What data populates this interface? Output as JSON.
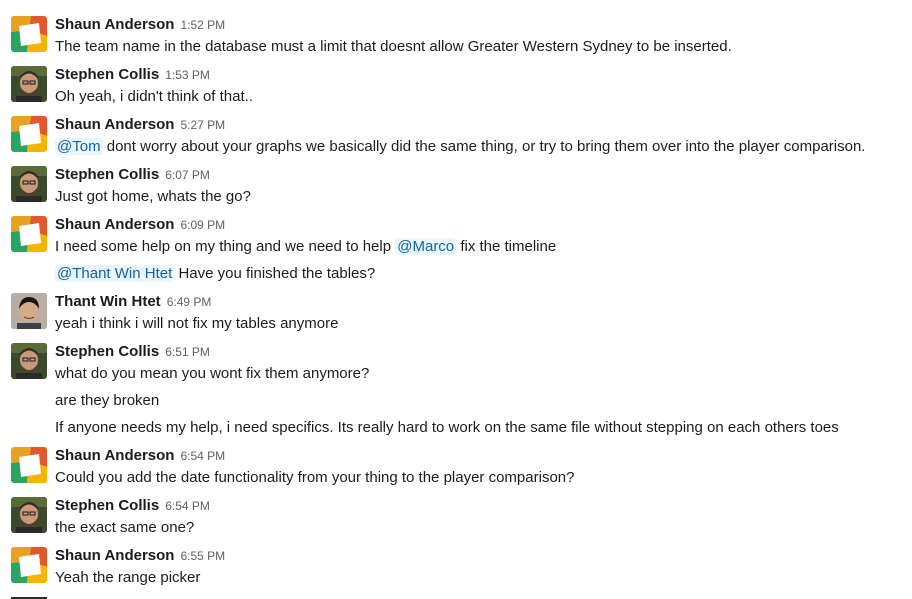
{
  "colors": {
    "mention_text": "#1264a3",
    "mention_bg": "#e8f5fa",
    "timestamp": "#616061"
  },
  "messages": [
    {
      "author": "Shaun Anderson",
      "time": "1:52 PM",
      "avatar": "shaun-avatar",
      "lines": [
        {
          "text": "The team name in the database must a limit that doesnt allow Greater Western Sydney to be inserted."
        }
      ]
    },
    {
      "author": "Stephen Collis",
      "time": "1:53 PM",
      "avatar": "stephen-avatar",
      "lines": [
        {
          "text": "Oh yeah, i didn't think of that.."
        }
      ]
    },
    {
      "author": "Shaun Anderson",
      "time": "5:27 PM",
      "avatar": "shaun-avatar",
      "lines": [
        {
          "mention": "@Tom",
          "text": "dont worry about your graphs we basically did the same thing, or try to bring them over into the player comparison."
        }
      ]
    },
    {
      "author": "Stephen Collis",
      "time": "6:07 PM",
      "avatar": "stephen-avatar",
      "lines": [
        {
          "text": "Just got home, whats the go?"
        }
      ]
    },
    {
      "author": "Shaun Anderson",
      "time": "6:09 PM",
      "avatar": "shaun-avatar",
      "lines": [
        {
          "text_before": "I need some help on my thing and we need to help",
          "mention": "@Marco",
          "text": "fix the timeline"
        },
        {
          "mention": "@Thant Win Htet",
          "text": "Have you finished the tables?"
        }
      ]
    },
    {
      "author": "Thant Win Htet",
      "time": "6:49 PM",
      "avatar": "thant-avatar",
      "lines": [
        {
          "text": "yeah i think i will not fix my tables anymore"
        }
      ]
    },
    {
      "author": "Stephen Collis",
      "time": "6:51 PM",
      "avatar": "stephen-avatar",
      "lines": [
        {
          "text": "what do you mean you wont fix them anymore?"
        },
        {
          "text": "are they broken"
        },
        {
          "text": "If anyone needs my help, i need specifics. Its really hard to work on the same file without stepping on each others toes"
        }
      ]
    },
    {
      "author": "Shaun Anderson",
      "time": "6:54 PM",
      "avatar": "shaun-avatar",
      "lines": [
        {
          "text": "Could you add the date functionality from your thing to the player comparison?"
        }
      ]
    },
    {
      "author": "Stephen Collis",
      "time": "6:54 PM",
      "avatar": "stephen-avatar",
      "lines": [
        {
          "text": "the exact same one?"
        }
      ]
    },
    {
      "author": "Shaun Anderson",
      "time": "6:55 PM",
      "avatar": "shaun-avatar",
      "lines": [
        {
          "text": "Yeah the range picker"
        }
      ]
    }
  ]
}
